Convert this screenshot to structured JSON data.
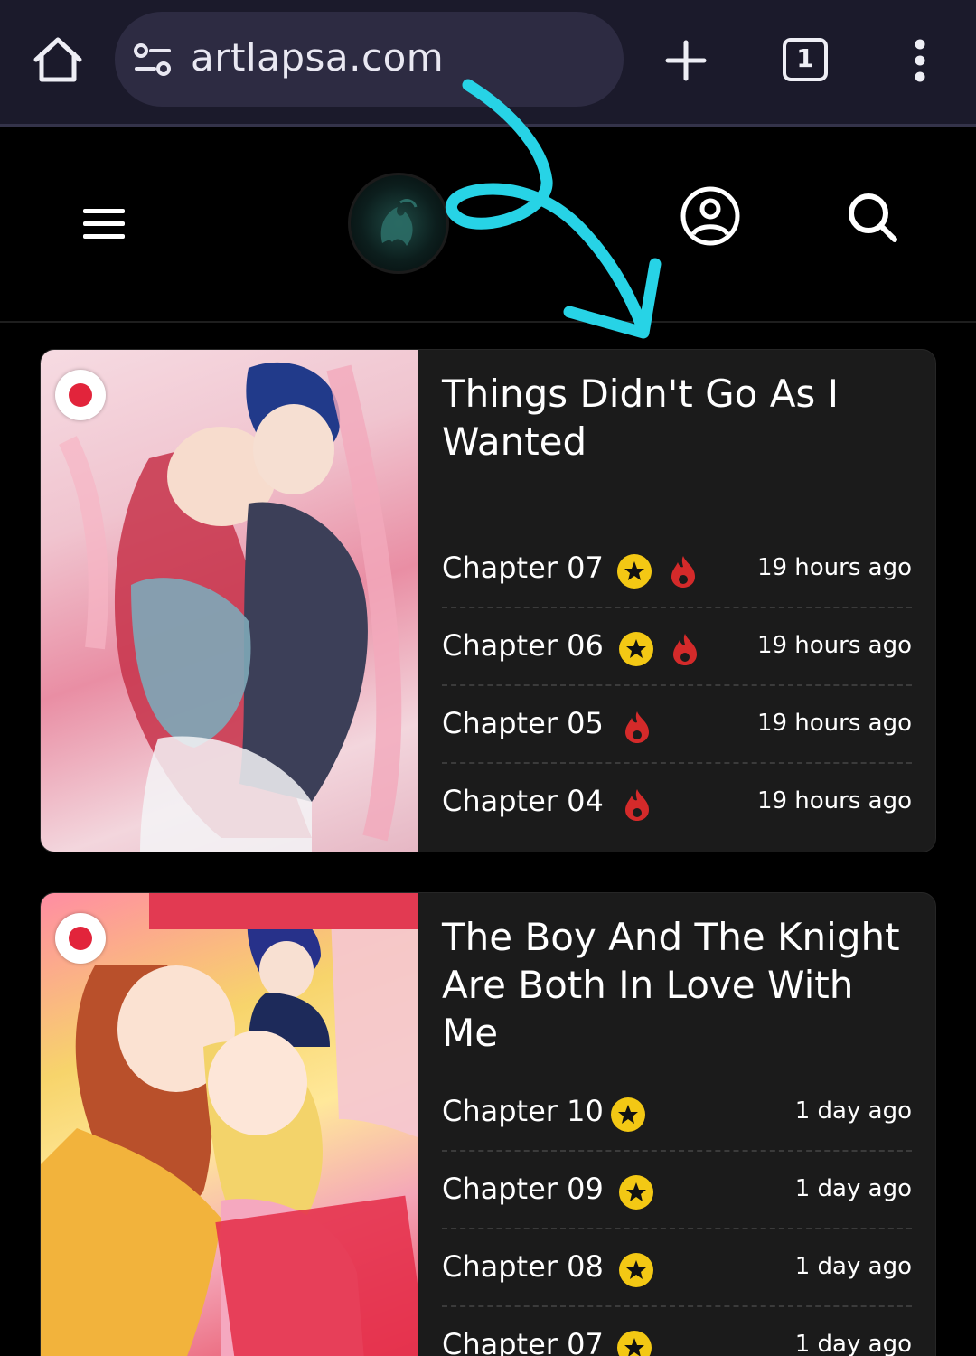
{
  "browser": {
    "url": "artlapsa.com",
    "tab_count": "1"
  },
  "cards": [
    {
      "title": "Things Didn't Go As I Wanted",
      "chapters": [
        {
          "label": "Chapter 07",
          "time": "19 hours ago",
          "star": true,
          "hot": true
        },
        {
          "label": "Chapter 06",
          "time": "19 hours ago",
          "star": true,
          "hot": true
        },
        {
          "label": "Chapter 05",
          "time": "19 hours ago",
          "star": false,
          "hot": true
        },
        {
          "label": "Chapter 04",
          "time": "19 hours ago",
          "star": false,
          "hot": true
        }
      ]
    },
    {
      "title": "The Boy And The Knight Are Both In Love With Me",
      "chapters": [
        {
          "label": "Chapter 10",
          "time": "1 day ago",
          "star": true,
          "hot": false
        },
        {
          "label": "Chapter 09",
          "time": "1 day ago",
          "star": true,
          "hot": false
        },
        {
          "label": "Chapter 08",
          "time": "1 day ago",
          "star": true,
          "hot": false
        },
        {
          "label": "Chapter 07",
          "time": "1 day ago",
          "star": true,
          "hot": false
        }
      ]
    }
  ],
  "colors": {
    "browser_bar": "#1b1a2b",
    "url_box": "#2d2b42",
    "card_bg": "#1b1b1b",
    "star_badge": "#f3c814",
    "fire_icon": "#d42a2a",
    "annotation": "#27d3e6"
  }
}
